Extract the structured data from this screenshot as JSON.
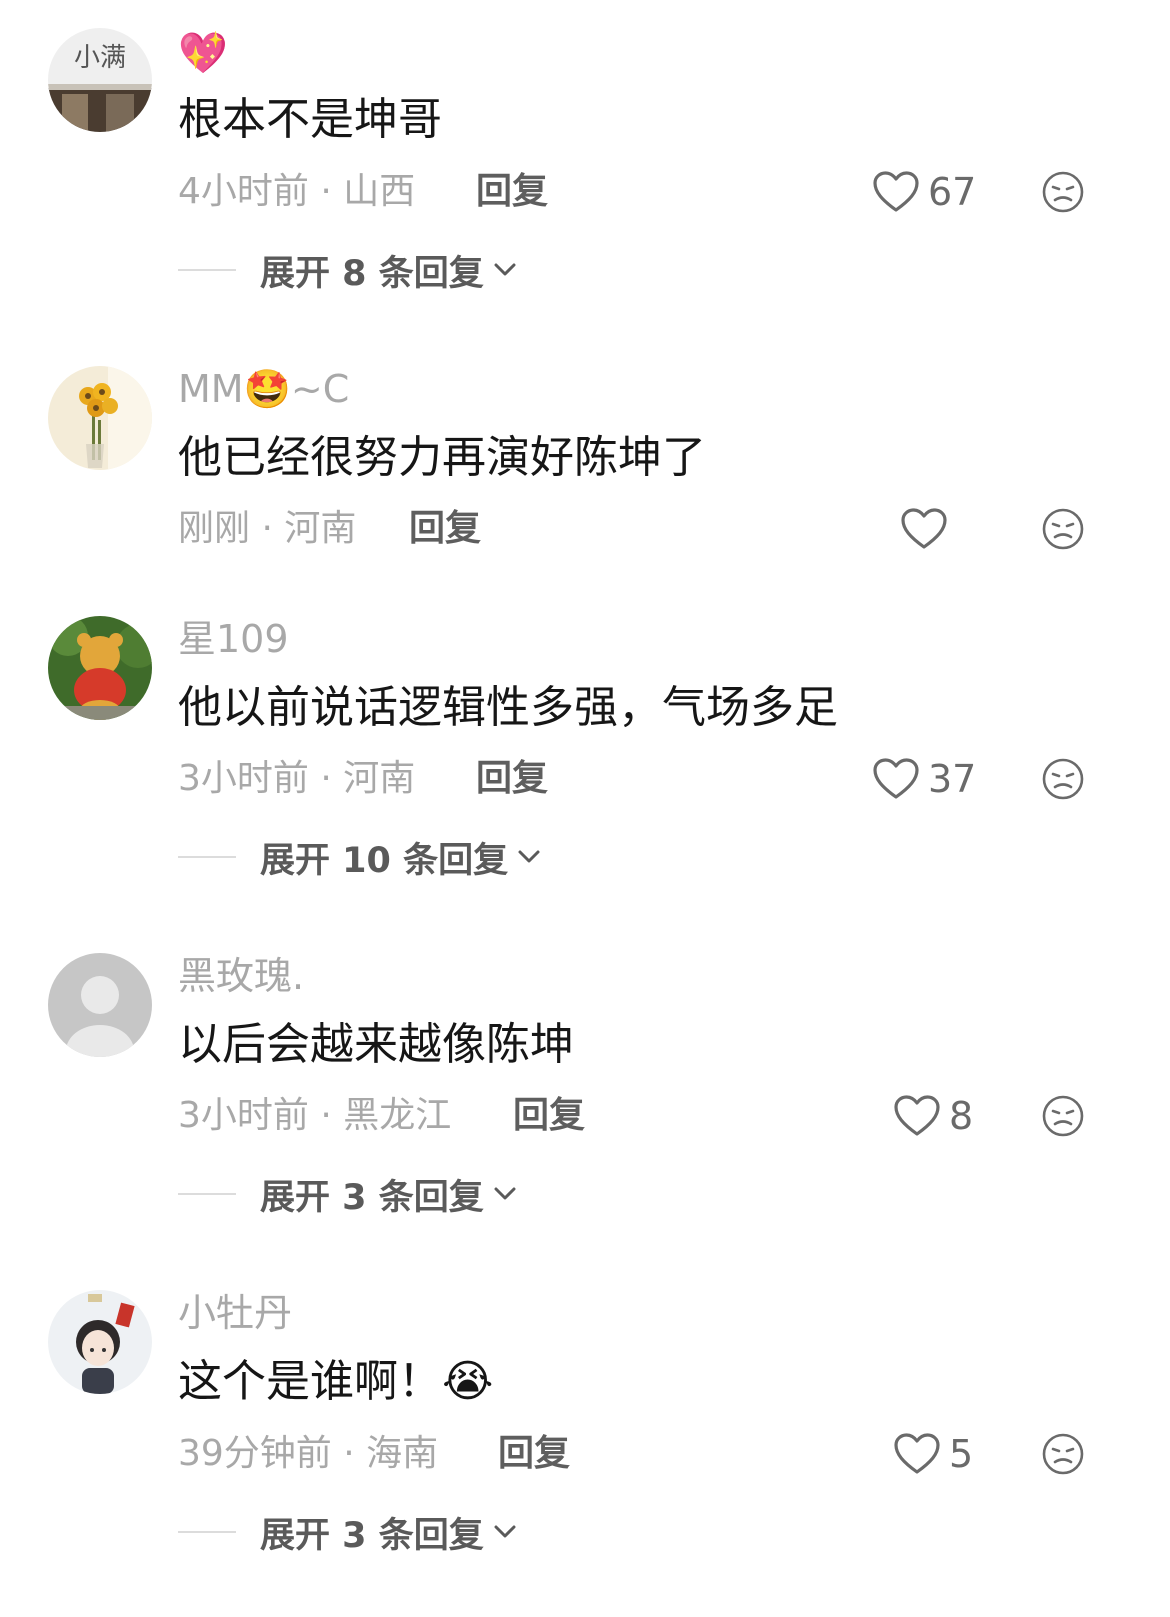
{
  "comments": [
    {
      "username": "",
      "username_emoji": "💖",
      "text": "根本不是坤哥",
      "time": "4小时前",
      "location": "山西",
      "meta": "4小时前 · 山西",
      "reply_label": "回复",
      "likes": "67",
      "expand_label": "展开 8 条回复"
    },
    {
      "username": "MM🤩~C",
      "text": "他已经很努力再演好陈坤了",
      "time": "刚刚",
      "location": "河南",
      "meta": "刚刚 · 河南",
      "reply_label": "回复",
      "likes": ""
    },
    {
      "username": "星109",
      "text": "他以前说话逻辑性多强，气场多足",
      "time": "3小时前",
      "location": "河南",
      "meta": "3小时前 · 河南",
      "reply_label": "回复",
      "likes": "37",
      "expand_label": "展开 10 条回复"
    },
    {
      "username": "黑玫瑰.",
      "text": "以后会越来越像陈坤",
      "time": "3小时前",
      "location": "黑龙江",
      "meta": "3小时前 · 黑龙江",
      "reply_label": "回复",
      "likes": "8",
      "expand_label": "展开 3 条回复"
    },
    {
      "username": "小牡丹",
      "text": "这个是谁啊！😭",
      "time": "39分钟前",
      "location": "海南",
      "meta": "39分钟前 · 海南",
      "reply_label": "回复",
      "likes": "5",
      "expand_label": "展开 3 条回复"
    }
  ],
  "avatar_logo_text": "小满",
  "icons": {
    "like": "heart-outline-icon",
    "dislike": "frown-face-icon",
    "expand": "chevron-down-icon"
  },
  "colors": {
    "text_primary": "#161616",
    "text_secondary": "#a8a8a8",
    "reply": "#5e5e5e"
  }
}
